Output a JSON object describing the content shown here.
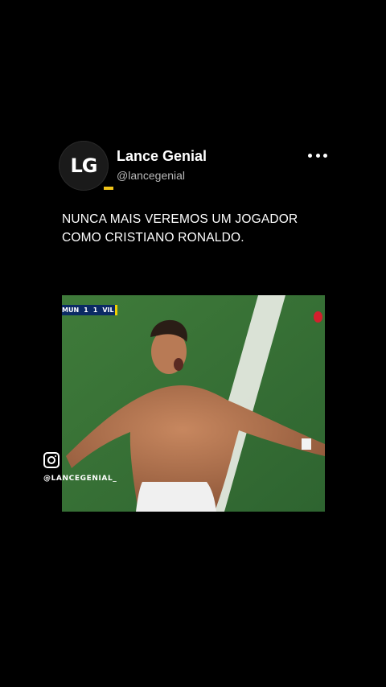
{
  "post": {
    "avatar_text": "LG",
    "display_name": "Lance Genial",
    "handle": "@lancegenial",
    "more_icon": "more-horizontal-icon",
    "caption": "NUNCA MAIS VEREMOS UM JOGADOR COMO CRISTIANO RONALDO."
  },
  "media": {
    "scorebug": {
      "home": "MUN",
      "home_score": "1",
      "away_score": "1",
      "away": "VIL"
    }
  },
  "watermark": {
    "icon": "instagram-icon",
    "handle": "@LANCEGENIAL_"
  },
  "colors": {
    "background": "#000000",
    "accent": "#f0c419",
    "pitch": "#3a7a35"
  }
}
